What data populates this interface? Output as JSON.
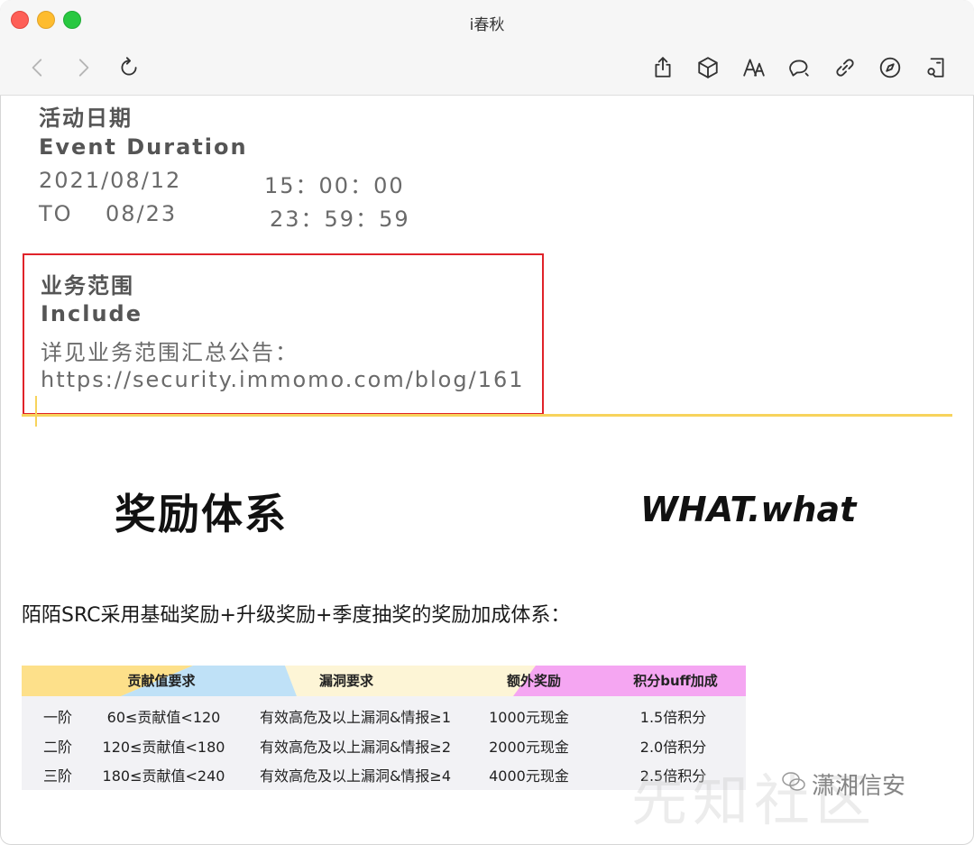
{
  "window": {
    "title": "i春秋"
  },
  "toolbar": {
    "icons": [
      "back-icon",
      "forward-icon",
      "reload-icon",
      "share-icon",
      "cube-icon",
      "font-size-icon",
      "comment-icon",
      "link-icon",
      "compass-icon",
      "reader-icon"
    ]
  },
  "event": {
    "label_cn": "活动日期",
    "label_en": "Event Duration",
    "start_date": "2021/08/12",
    "start_time": "15：00：00",
    "end_prefix": "TO",
    "end_date": "08/23",
    "end_time": "23：59：59"
  },
  "scope": {
    "label_cn": "业务范围",
    "label_en": "Include",
    "note": "详见业务范围汇总公告：",
    "url": "https://security.immomo.com/blog/161"
  },
  "reward": {
    "heading_cn": "奖励体系",
    "heading_en": "WHAT.what",
    "description": "陌陌SRC采用基础奖励+升级奖励+季度抽奖的奖励加成体系："
  },
  "table": {
    "headers": [
      "贡献值要求",
      "漏洞要求",
      "额外奖励",
      "积分buff加成"
    ],
    "rows": [
      [
        "一阶",
        "60≤贡献值<120",
        "有效高危及以上漏洞&情报≥1",
        "1000元现金",
        "1.5倍积分"
      ],
      [
        "二阶",
        "120≤贡献值<180",
        "有效高危及以上漏洞&情报≥2",
        "2000元现金",
        "2.0倍积分"
      ],
      [
        "三阶",
        "180≤贡献值<240",
        "有效高危及以上漏洞&情报≥4",
        "4000元现金",
        "2.5倍积分"
      ]
    ]
  },
  "watermark": {
    "large_text": "先知社区",
    "account_name": "潇湘信安"
  }
}
